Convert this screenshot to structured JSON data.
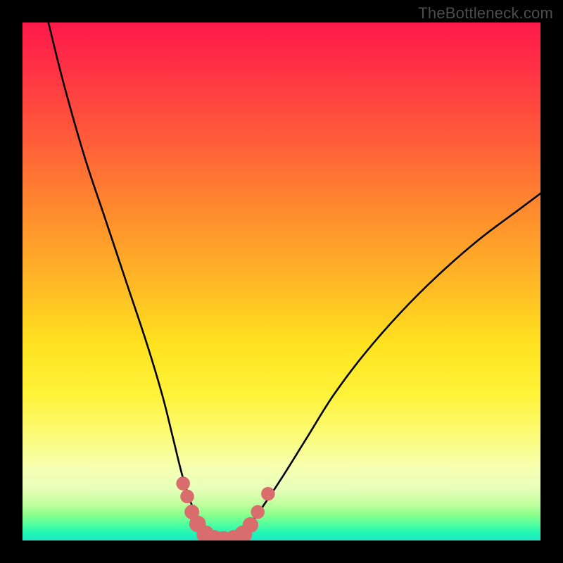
{
  "watermark": "TheBottleneck.com",
  "chart_data": {
    "type": "line",
    "title": "",
    "xlabel": "",
    "ylabel": "",
    "xlim": [
      0,
      100
    ],
    "ylim": [
      0,
      100
    ],
    "grid": false,
    "series": [
      {
        "name": "curve",
        "x": [
          5,
          8,
          12,
          16,
          20,
          24,
          27,
          29,
          31,
          33,
          35,
          37,
          39,
          41,
          43,
          46,
          50,
          55,
          60,
          66,
          73,
          80,
          88,
          96,
          100
        ],
        "y": [
          100,
          88,
          74,
          62,
          50,
          38,
          28,
          20,
          12,
          6,
          2,
          0,
          0,
          0,
          2,
          6,
          12,
          20,
          28,
          36,
          44,
          51,
          58,
          64,
          67
        ]
      }
    ],
    "markers": [
      {
        "name": "marker",
        "x": 31.0,
        "y": 11.0,
        "r": 1.4
      },
      {
        "name": "marker",
        "x": 31.8,
        "y": 8.5,
        "r": 1.4
      },
      {
        "name": "marker",
        "x": 32.7,
        "y": 5.5,
        "r": 1.5
      },
      {
        "name": "marker",
        "x": 33.8,
        "y": 3.2,
        "r": 1.7
      },
      {
        "name": "marker",
        "x": 35.3,
        "y": 1.2,
        "r": 1.8
      },
      {
        "name": "marker",
        "x": 37.0,
        "y": 0.3,
        "r": 1.8
      },
      {
        "name": "marker",
        "x": 38.8,
        "y": 0.1,
        "r": 1.8
      },
      {
        "name": "marker",
        "x": 40.8,
        "y": 0.3,
        "r": 1.8
      },
      {
        "name": "marker",
        "x": 42.6,
        "y": 1.2,
        "r": 1.8
      },
      {
        "name": "marker",
        "x": 44.0,
        "y": 3.0,
        "r": 1.6
      },
      {
        "name": "marker",
        "x": 45.4,
        "y": 5.5,
        "r": 1.4
      },
      {
        "name": "marker",
        "x": 47.4,
        "y": 9.0,
        "r": 1.4
      }
    ],
    "marker_color": "#d96d6d",
    "curve_color": "#000000",
    "gradient_stops": [
      {
        "pos": 0,
        "color": "#ff1a4b"
      },
      {
        "pos": 8,
        "color": "#ff2f45"
      },
      {
        "pos": 22,
        "color": "#ff5a3a"
      },
      {
        "pos": 36,
        "color": "#ff8a2e"
      },
      {
        "pos": 50,
        "color": "#ffb726"
      },
      {
        "pos": 62,
        "color": "#ffe21f"
      },
      {
        "pos": 72,
        "color": "#fff33a"
      },
      {
        "pos": 80,
        "color": "#fbfc7a"
      },
      {
        "pos": 86,
        "color": "#f6ffb2"
      },
      {
        "pos": 90,
        "color": "#e7ffb9"
      },
      {
        "pos": 93,
        "color": "#c0ff9e"
      },
      {
        "pos": 95,
        "color": "#8dff8c"
      },
      {
        "pos": 97,
        "color": "#4effa0"
      },
      {
        "pos": 98.5,
        "color": "#23f7b7"
      },
      {
        "pos": 100,
        "color": "#1ee6c4"
      }
    ]
  }
}
